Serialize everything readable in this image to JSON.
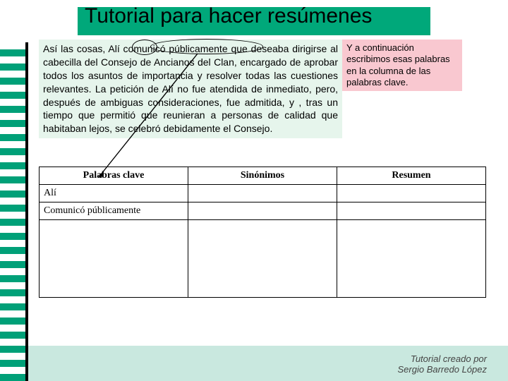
{
  "title": "Tutorial para hacer resúmenes",
  "main_paragraph": "Así las cosas, Alí comunicó públicamente que deseaba dirigirse al cabecilla del Consejo de Ancianos del Clan, encargado de aprobar todos los asuntos de importancia y resolver todas las cuestiones relevantes. La petición de Alí no fue atendida de inmediato, pero, después de ambiguas consideraciones, fue admitida, y , tras un tiempo que permitió que reunieran a personas de calidad que habitaban lejos, se celebró debidamente el Consejo.",
  "side_note": "Y a continuación escribimos esas palabras en la columna de las palabras clave.",
  "table": {
    "headers": {
      "col1": "Palabras clave",
      "col2": "Sinónimos",
      "col3": "Resumen"
    },
    "rows": [
      {
        "key": "Alí",
        "syn": "",
        "res": ""
      },
      {
        "key": "Comunicó públicamente",
        "syn": "",
        "res": ""
      }
    ]
  },
  "footer": {
    "line1": "Tutorial creado por",
    "line2": "Sergio Barredo López"
  }
}
